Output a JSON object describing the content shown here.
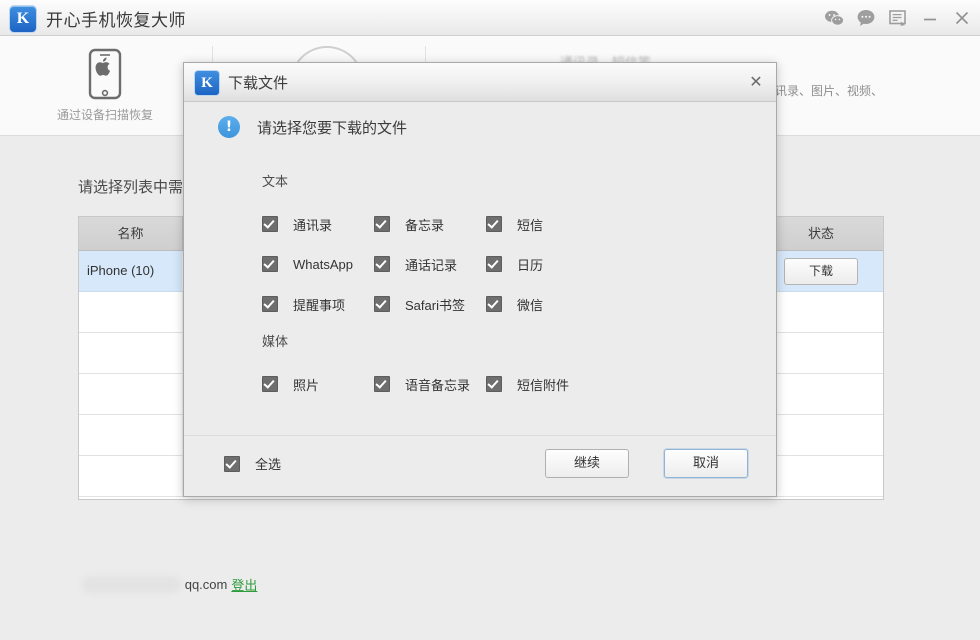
{
  "window": {
    "title": "开心手机恢复大师",
    "logo_letter": "K",
    "icons": [
      {
        "name": "wechat-icon"
      },
      {
        "name": "chat-bubble-icon"
      },
      {
        "name": "feedback-icon"
      },
      {
        "name": "minimize-icon"
      },
      {
        "name": "close-icon"
      }
    ]
  },
  "source_bar": {
    "items": [
      {
        "icon": "iphone-device-icon",
        "label": "通过设备扫描恢复"
      },
      {
        "icon": "icloud-backup-icon",
        "label": ""
      },
      {
        "icon": "itunes-backup-icon",
        "label": ""
      }
    ],
    "background_text_center": "通讯录、短信等",
    "background_text_right": "讯录、图片、视频、"
  },
  "main": {
    "hint": "请选择列表中需",
    "table": {
      "columns": [
        "名称",
        "",
        "",
        "",
        "状态"
      ],
      "rows": [
        {
          "name": "iPhone (10)",
          "c2": "",
          "c3": "",
          "c4": "",
          "status_button": "下载",
          "selected": true
        },
        {
          "name": "",
          "c2": "",
          "c3": "",
          "c4": "",
          "status_button": "",
          "selected": false
        },
        {
          "name": "",
          "c2": "",
          "c3": "",
          "c4": "",
          "status_button": "",
          "selected": false
        },
        {
          "name": "",
          "c2": "",
          "c3": "",
          "c4": "",
          "status_button": "",
          "selected": false
        },
        {
          "name": "",
          "c2": "",
          "c3": "",
          "c4": "",
          "status_button": "",
          "selected": false
        },
        {
          "name": "",
          "c2": "",
          "c3": "",
          "c4": "",
          "status_button": "",
          "selected": false
        }
      ]
    },
    "account": {
      "email_masked": "XXXXXXXXXX",
      "email_suffix": "qq.com",
      "logout_label": "登出"
    }
  },
  "dialog": {
    "logo_letter": "K",
    "title": "下载文件",
    "close_glyph": "✕",
    "info_glyph": "!",
    "prompt": "请选择您要下载的文件",
    "groups": [
      {
        "title": "文本",
        "items": [
          {
            "label": "通讯录",
            "checked": true
          },
          {
            "label": "备忘录",
            "checked": true
          },
          {
            "label": "短信",
            "checked": true
          },
          {
            "label": "WhatsApp",
            "checked": true
          },
          {
            "label": "通话记录",
            "checked": true
          },
          {
            "label": "日历",
            "checked": true
          },
          {
            "label": "提醒事项",
            "checked": true
          },
          {
            "label": "Safari书签",
            "checked": true
          },
          {
            "label": "微信",
            "checked": true
          }
        ]
      },
      {
        "title": "媒体",
        "items": [
          {
            "label": "照片",
            "checked": true
          },
          {
            "label": "语音备忘录",
            "checked": true
          },
          {
            "label": "短信附件",
            "checked": true
          }
        ]
      }
    ],
    "select_all": {
      "label": "全选",
      "checked": true
    },
    "continue_label": "继续",
    "cancel_label": "取消"
  },
  "colors": {
    "accent_blue": "#2d6fc4",
    "link_green": "#2e9c3c",
    "row_selected": "#d6e8f9",
    "checkbox_fill": "#6e6e6e"
  }
}
